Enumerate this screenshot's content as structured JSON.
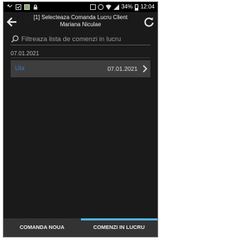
{
  "status_bar": {
    "battery": "34%",
    "time": "12:04",
    "left_icons": [
      "missed-call-icon",
      "check-icon",
      "photo-icon",
      "lock-icon"
    ],
    "right_icons": [
      "nfc-icon",
      "data-saver-icon",
      "wifi-icon",
      "signal-icon",
      "battery-icon"
    ]
  },
  "header": {
    "title_line1": "[1] Selecteaza Comanda Lucru Client",
    "title_line2": "Mariana Niculae"
  },
  "search": {
    "placeholder": "Filtreaza lista de comenzi in lucru",
    "value": ""
  },
  "list": {
    "section_date": "07.01.2021",
    "items": [
      {
        "client": "Ula",
        "date": "07.01.2021"
      }
    ]
  },
  "tabs": [
    {
      "label": "COMANDA NOUA",
      "active": false
    },
    {
      "label": "COMENZI IN LUCRU",
      "active": true
    }
  ],
  "colors": {
    "accent": "#4fb3e6",
    "client_link": "#3d72c8",
    "background": "#1a1a1a",
    "row": "#3e3e3e",
    "tab_bar": "#333333"
  }
}
